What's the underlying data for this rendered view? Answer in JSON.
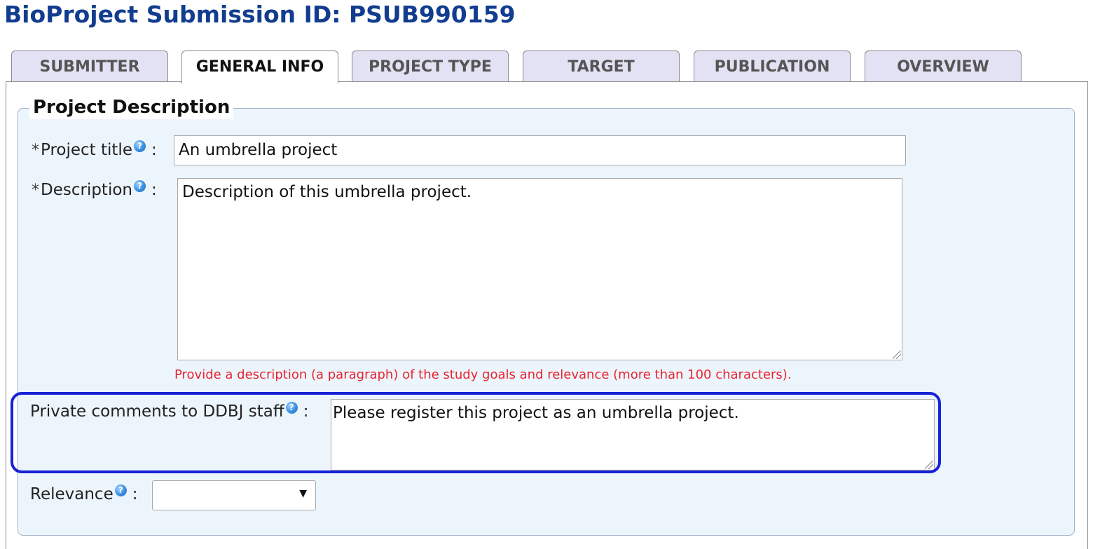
{
  "header": {
    "title": "BioProject Submission ID: PSUB990159"
  },
  "tabs": [
    {
      "label": "SUBMITTER",
      "active": false
    },
    {
      "label": "GENERAL INFO",
      "active": true
    },
    {
      "label": "PROJECT TYPE",
      "active": false
    },
    {
      "label": "TARGET",
      "active": false
    },
    {
      "label": "PUBLICATION",
      "active": false
    },
    {
      "label": "OVERVIEW",
      "active": false
    }
  ],
  "project_description": {
    "legend": "Project Description",
    "required_marker": "*",
    "colon": ":",
    "help_icon_glyph": "?",
    "title_field": {
      "label": "Project title",
      "value": "An umbrella project"
    },
    "description_field": {
      "label": "Description",
      "value": "Description of this umbrella project.",
      "hint": "Provide a description (a paragraph) of the study goals and relevance (more than 100 characters)."
    },
    "private_comments_field": {
      "label": "Private comments to DDBJ staff",
      "value": "Please register this project as an umbrella project."
    },
    "relevance_field": {
      "label": "Relevance",
      "value": "",
      "arrow": "▼"
    }
  },
  "colors": {
    "title": "#123d8f",
    "tab_inactive_bg": "#e2e2f4",
    "fieldset_bg": "#edf5fc",
    "hint_text": "#e8242f",
    "highlight_border": "#1722d6"
  }
}
